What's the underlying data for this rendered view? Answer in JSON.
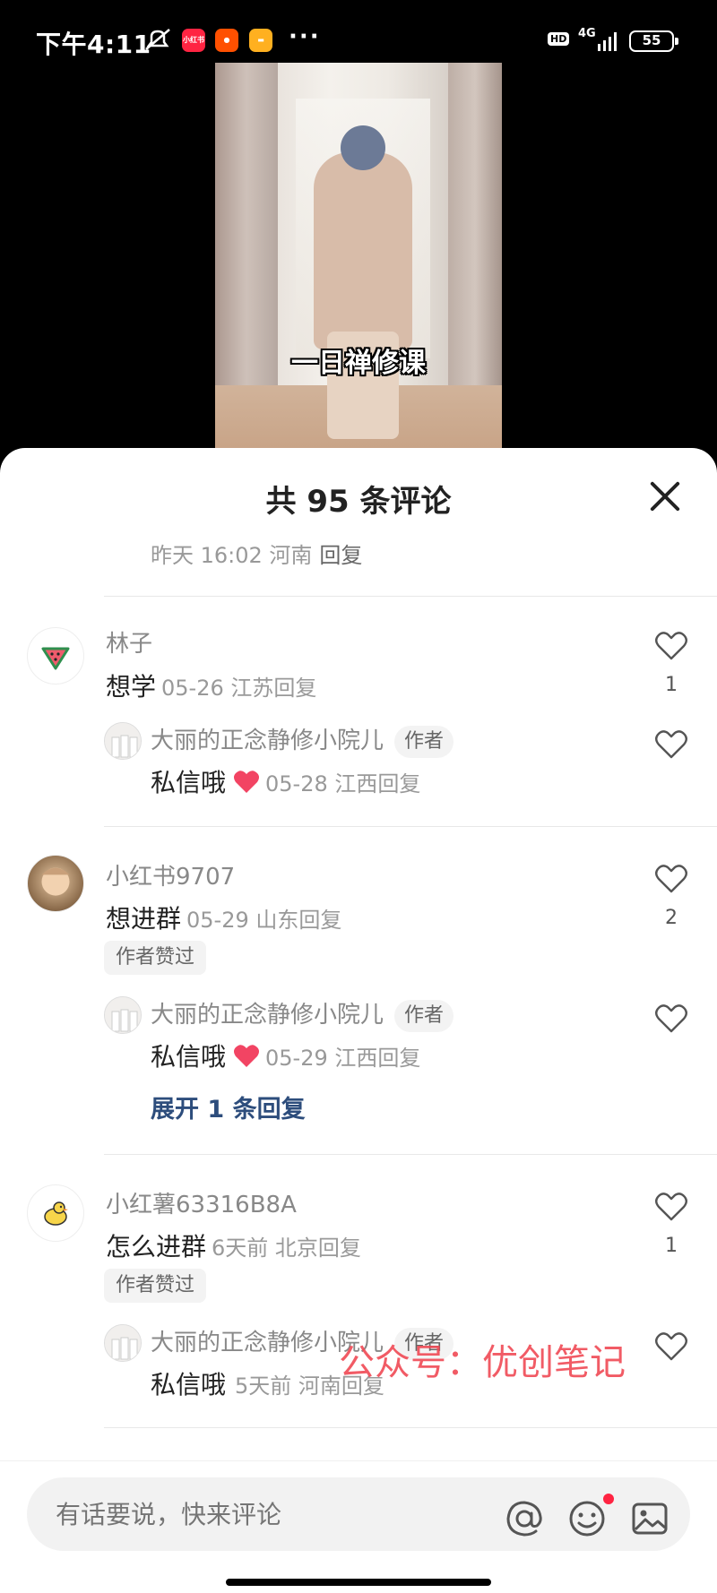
{
  "status_bar": {
    "time": "下午4:11",
    "app_badges": [
      "小红书",
      "淘宝",
      "消息"
    ],
    "more": "···",
    "hd": "HD",
    "network": "4G",
    "battery": "55"
  },
  "video": {
    "caption": "一日禅修课"
  },
  "sheet": {
    "title": "共 95 条评论",
    "previous_meta": {
      "time": "昨天 16:02 河南",
      "reply": "回复"
    }
  },
  "comments": [
    {
      "name": "林子",
      "text": "想学",
      "meta": "05-26 江苏",
      "reply": "回复",
      "likes": "1",
      "sub": {
        "name": "大丽的正念静修小院儿",
        "tag": "作者",
        "text": "私信哦",
        "meta": "05-28 江西",
        "reply": "回复"
      }
    },
    {
      "name": "小红书9707",
      "text": "想进群",
      "meta": "05-29 山东",
      "reply": "回复",
      "likes": "2",
      "liked_by_author": "作者赞过",
      "sub": {
        "name": "大丽的正念静修小院儿",
        "tag": "作者",
        "text": "私信哦",
        "meta": "05-29 江西",
        "reply": "回复"
      },
      "expand": "展开 1 条回复"
    },
    {
      "name": "小红薯63316B8A",
      "text": "怎么进群",
      "meta": "6天前  北京",
      "reply": "回复",
      "likes": "1",
      "liked_by_author": "作者赞过",
      "sub": {
        "name": "大丽的正念静修小院儿",
        "tag": "作者",
        "text": "私信哦",
        "meta": "5天前  河南",
        "reply": "回复"
      }
    }
  ],
  "watermark": "公众号：优创笔记",
  "input": {
    "placeholder": "有话要说，快来评论"
  },
  "colors": {
    "accent": "#ff2442",
    "link": "#2d4d7c",
    "watermark": "#f04a55"
  }
}
